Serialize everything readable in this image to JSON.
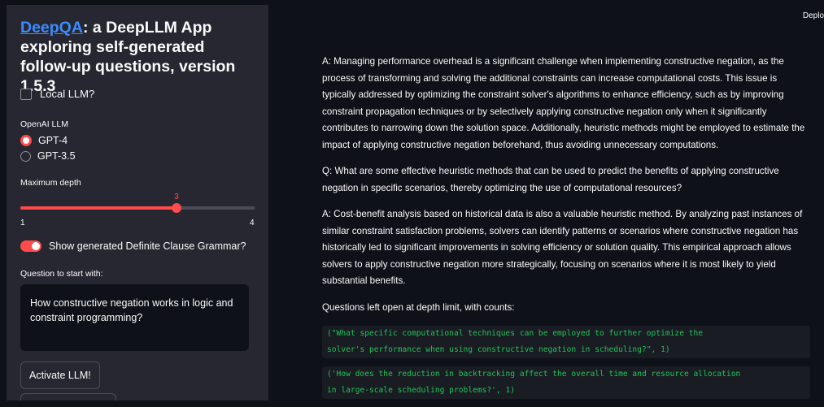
{
  "sidebar": {
    "title_link": "DeepQA",
    "title_rest": ": a DeepLLM App exploring self-generated follow-up questions, version 1.5.3",
    "local_llm_label": "Local LLM?",
    "openai_label": "OpenAI LLM",
    "radio_options": [
      {
        "label": "GPT-4",
        "selected": true
      },
      {
        "label": "GPT-3.5",
        "selected": false
      }
    ],
    "depth_label": "Maximum depth",
    "depth_value": "3",
    "depth_min": "1",
    "depth_max": "4",
    "depth_fraction": 0.6667,
    "toggle_label": "Show generated Definite Clause Grammar?",
    "toggle_on": true,
    "question_label": "Question to start with:",
    "question_value": "How constructive negation works in logic and constraint programming?",
    "activate_button": "Activate LLM!"
  },
  "header": {
    "deploy": "Deplo"
  },
  "main": {
    "paragraphs": [
      "A: Managing performance overhead is a significant challenge when implementing constructive negation, as the process of transforming and solving the additional constraints can increase computational costs. This issue is typically addressed by optimizing the constraint solver's algorithms to enhance efficiency, such as by improving constraint propagation techniques or by selectively applying constructive negation only when it significantly contributes to narrowing down the solution space. Additionally, heuristic methods might be employed to estimate the impact of applying constructive negation beforehand, thus avoiding unnecessary computations.",
      "Q: What are some effective heuristic methods that can be used to predict the benefits of applying constructive negation in specific scenarios, thereby optimizing the use of computational resources?",
      "A: Cost-benefit analysis based on historical data is also a valuable heuristic method. By analyzing past instances of similar constraint satisfaction problems, solvers can identify patterns or scenarios where constructive negation has historically led to significant improvements in solving efficiency or solution quality. This empirical approach allows solvers to apply constructive negation more strategically, focusing on scenarios where it is most likely to yield substantial benefits.",
      "Questions left open at depth limit, with counts:"
    ],
    "code_blocks": [
      [
        "(\"What specific computational techniques can be employed to further optimize the",
        "solver's performance when using constructive negation in scheduling?\", 1)"
      ],
      [
        "('How does the reduction in backtracking affect the overall time and resource allocation",
        "in large-scale scheduling problems?', 1)"
      ]
    ]
  }
}
